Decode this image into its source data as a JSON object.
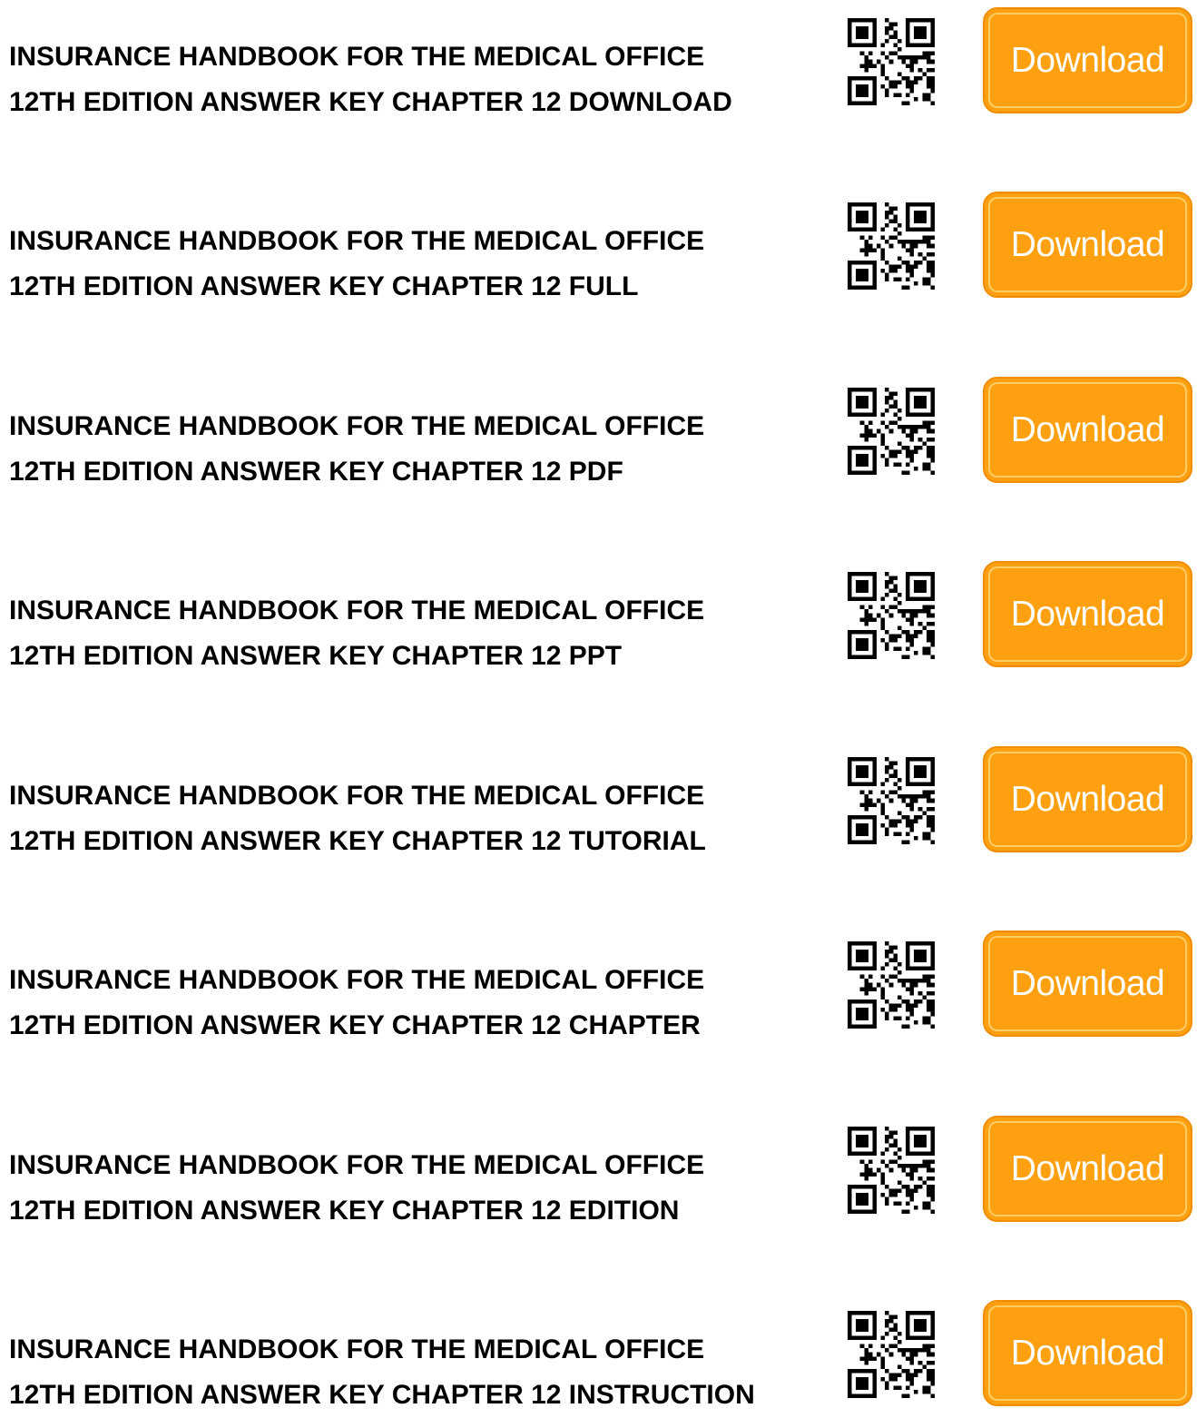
{
  "items": [
    {
      "line1": "INSURANCE HANDBOOK FOR THE MEDICAL OFFICE",
      "line2": "12TH EDITION ANSWER KEY CHAPTER 12 DOWNLOAD",
      "button": "Download"
    },
    {
      "line1": "INSURANCE HANDBOOK FOR THE MEDICAL OFFICE",
      "line2": "12TH EDITION ANSWER KEY CHAPTER 12 FULL",
      "button": "Download"
    },
    {
      "line1": "INSURANCE HANDBOOK FOR THE MEDICAL OFFICE",
      "line2": "12TH EDITION ANSWER KEY CHAPTER 12 PDF",
      "button": "Download"
    },
    {
      "line1": "INSURANCE HANDBOOK FOR THE MEDICAL OFFICE",
      "line2": "12TH EDITION ANSWER KEY CHAPTER 12 PPT",
      "button": "Download"
    },
    {
      "line1": "INSURANCE HANDBOOK FOR THE MEDICAL OFFICE",
      "line2": "12TH EDITION ANSWER KEY CHAPTER 12 TUTORIAL",
      "button": "Download"
    },
    {
      "line1": "INSURANCE HANDBOOK FOR THE MEDICAL OFFICE",
      "line2": "12TH EDITION ANSWER KEY CHAPTER 12 CHAPTER",
      "button": "Download"
    },
    {
      "line1": "INSURANCE HANDBOOK FOR THE MEDICAL OFFICE",
      "line2": "12TH EDITION ANSWER KEY CHAPTER 12 EDITION",
      "button": "Download"
    },
    {
      "line1": "INSURANCE HANDBOOK FOR THE MEDICAL OFFICE",
      "line2": "12TH EDITION ANSWER KEY CHAPTER 12 INSTRUCTION",
      "button": "Download"
    }
  ],
  "qr_icon": "qr-code-icon",
  "colors": {
    "button_bg": "#ffa010",
    "button_border": "#f08c00",
    "button_text": "#ffffff",
    "title_text": "#000000"
  }
}
